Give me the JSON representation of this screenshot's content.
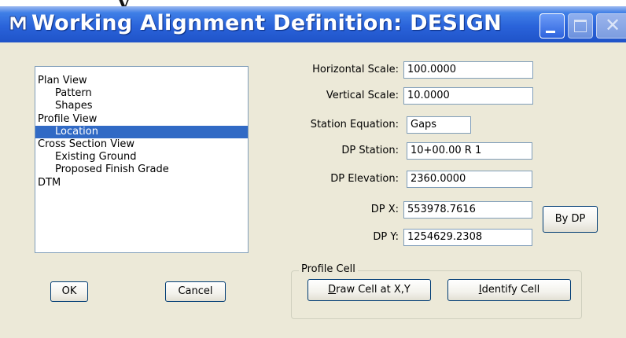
{
  "window": {
    "title": "Working Alignment Definition: DESIGN",
    "accent": "#2a63da"
  },
  "overflow_text": "y",
  "tree": {
    "items": [
      {
        "label": "Plan View",
        "level": 1,
        "selected": false
      },
      {
        "label": "Pattern",
        "level": 2,
        "selected": false
      },
      {
        "label": "Shapes",
        "level": 2,
        "selected": false
      },
      {
        "label": "Profile View",
        "level": 1,
        "selected": false
      },
      {
        "label": "Location",
        "level": 2,
        "selected": true
      },
      {
        "label": "Cross Section View",
        "level": 1,
        "selected": false
      },
      {
        "label": "Existing Ground",
        "level": 2,
        "selected": false
      },
      {
        "label": "Proposed Finish Grade",
        "level": 2,
        "selected": false
      },
      {
        "label": "DTM",
        "level": 1,
        "selected": false
      }
    ]
  },
  "buttons": {
    "ok": "OK",
    "cancel": "Cancel",
    "by_dp": "By DP",
    "draw_cell_first": "D",
    "draw_cell_rest": "raw Cell at X,Y",
    "identify_cell_first": "I",
    "identify_cell_rest": "dentify Cell"
  },
  "fields": {
    "horizontal_scale": {
      "label": "Horizontal Scale:",
      "value": "100.0000"
    },
    "vertical_scale": {
      "label": "Vertical Scale:",
      "value": "10.0000"
    },
    "station_equation": {
      "label": "Station Equation:",
      "value": "Gaps"
    },
    "dp_station": {
      "label": "DP Station:",
      "value": "10+00.00 R 1"
    },
    "dp_elevation": {
      "label": "DP Elevation:",
      "value": "2360.0000"
    },
    "dp_x": {
      "label": "DP X:",
      "value": "553978.7616"
    },
    "dp_y": {
      "label": "DP Y:",
      "value": "1254629.2308"
    }
  },
  "profile_cell": {
    "title": "Profile Cell"
  }
}
